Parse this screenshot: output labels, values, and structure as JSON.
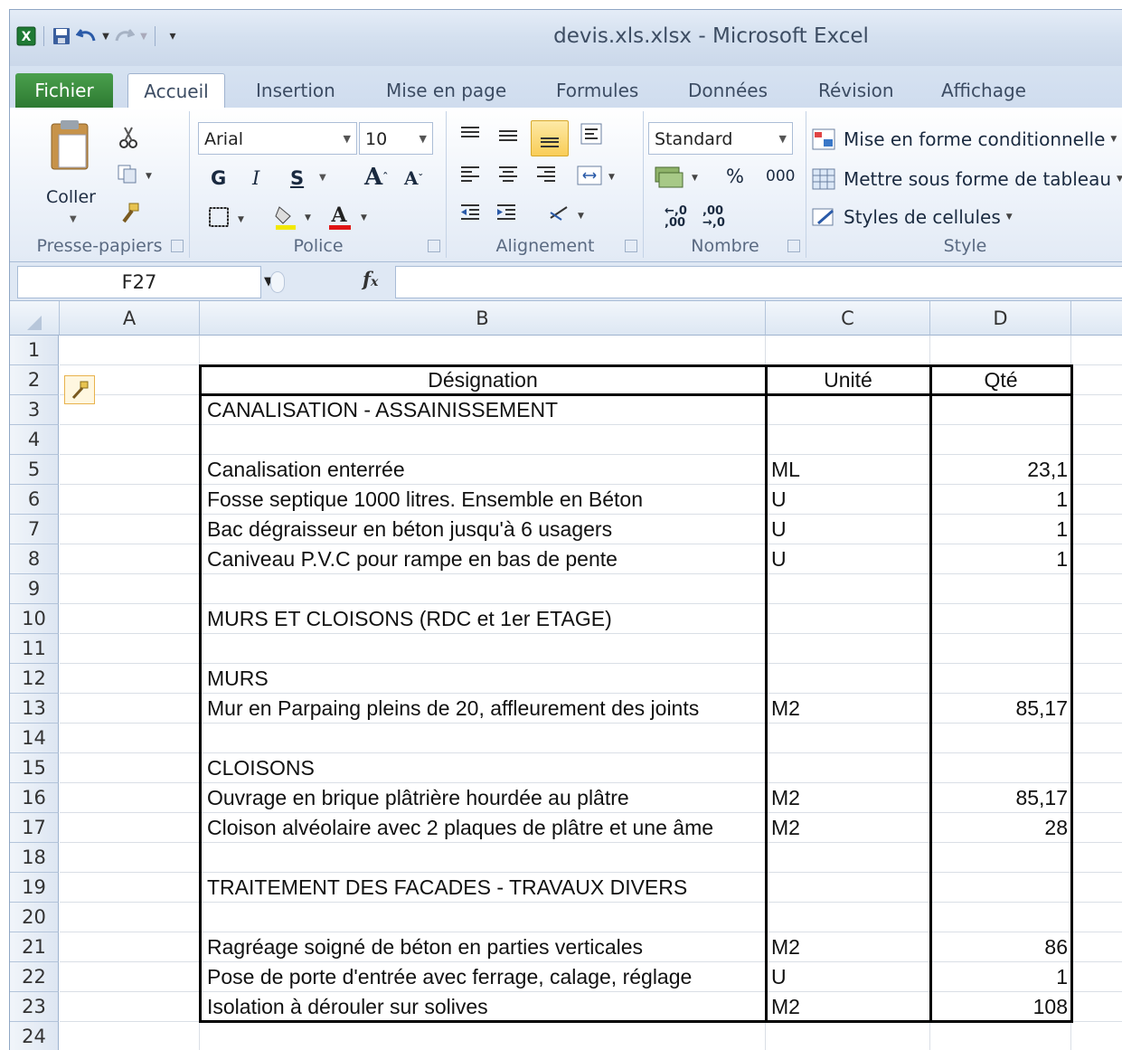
{
  "window": {
    "filename": "devis.xls.xlsx",
    "title_sep": "-",
    "app": "Microsoft Excel"
  },
  "tabs": [
    "Fichier",
    "Accueil",
    "Insertion",
    "Mise en page",
    "Formules",
    "Données",
    "Révision",
    "Affichage"
  ],
  "ribbon": {
    "clipboard": {
      "paste_label": "Coller",
      "group_label": "Presse-papiers"
    },
    "font": {
      "name": "Arial",
      "size": "10",
      "bold": "G",
      "italic": "I",
      "underline": "S",
      "group_label": "Police"
    },
    "alignment": {
      "group_label": "Alignement"
    },
    "number": {
      "format": "Standard",
      "percent": "%",
      "thousands": "000",
      "group_label": "Nombre"
    },
    "style": {
      "conditional": "Mise en forme conditionnelle",
      "as_table": "Mettre sous forme de tableau",
      "cell_styles": "Styles de cellules",
      "group_label": "Style"
    }
  },
  "formula_bar": {
    "name_box": "F27",
    "fx": "fx",
    "formula": ""
  },
  "columns": [
    "A",
    "B",
    "C",
    "D"
  ],
  "rows": [
    "1",
    "2",
    "3",
    "4",
    "5",
    "6",
    "7",
    "8",
    "9",
    "10",
    "11",
    "12",
    "13",
    "14",
    "15",
    "16",
    "17",
    "18",
    "19",
    "20",
    "21",
    "22",
    "23",
    "24"
  ],
  "table": {
    "headers": {
      "designation": "Désignation",
      "unit": "Unité",
      "qty": "Qté"
    },
    "rows": [
      {
        "row": 3,
        "b": "CANALISATION - ASSAINISSEMENT",
        "c": "",
        "d": ""
      },
      {
        "row": 5,
        "b": "Canalisation enterrée",
        "c": "ML",
        "d": "23,1"
      },
      {
        "row": 6,
        "b": "Fosse septique 1000 litres. Ensemble en Béton",
        "c": "U",
        "d": "1"
      },
      {
        "row": 7,
        "b": "Bac dégraisseur en béton jusqu'à 6 usagers",
        "c": "U",
        "d": "1"
      },
      {
        "row": 8,
        "b": "Caniveau P.V.C pour rampe en bas de pente",
        "c": "U",
        "d": "1"
      },
      {
        "row": 10,
        "b": "MURS ET CLOISONS (RDC et 1er ETAGE)",
        "c": "",
        "d": ""
      },
      {
        "row": 12,
        "b": "MURS",
        "c": "",
        "d": ""
      },
      {
        "row": 13,
        "b": "Mur en Parpaing pleins de 20, affleurement des joints",
        "c": "M2",
        "d": "85,17"
      },
      {
        "row": 15,
        "b": "CLOISONS",
        "c": "",
        "d": ""
      },
      {
        "row": 16,
        "b": "Ouvrage en brique plâtrière hourdée au plâtre",
        "c": "M2",
        "d": "85,17"
      },
      {
        "row": 17,
        "b": "Cloison alvéolaire avec 2 plaques de plâtre et une âme",
        "c": "M2",
        "d": "28"
      },
      {
        "row": 19,
        "b": "TRAITEMENT DES FACADES - TRAVAUX DIVERS",
        "c": "",
        "d": ""
      },
      {
        "row": 21,
        "b": "Ragréage soigné de béton en parties verticales",
        "c": "M2",
        "d": "86"
      },
      {
        "row": 22,
        "b": "Pose de porte d'entrée avec ferrage, calage, réglage",
        "c": "U",
        "d": "1"
      },
      {
        "row": 23,
        "b": "Isolation à dérouler sur solives",
        "c": "M2",
        "d": "108"
      }
    ]
  },
  "colors": {
    "file_tab": "#2d7a31",
    "border": "#000000",
    "ribbon_bg": "#eef3fa"
  }
}
